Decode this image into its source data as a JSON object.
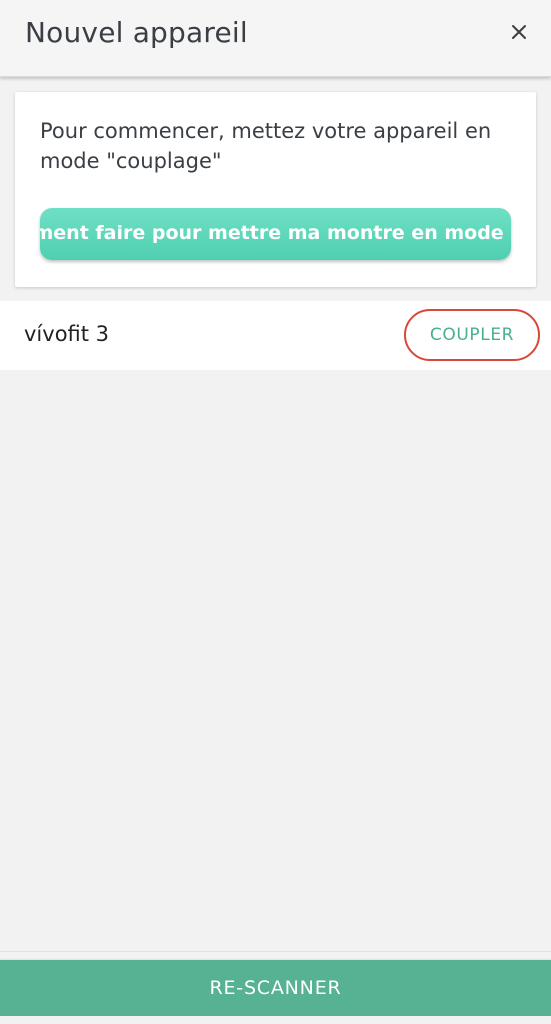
{
  "header": {
    "title": "Nouvel appareil",
    "close_icon": "close-icon"
  },
  "card": {
    "instruction": "Pour commencer, mettez votre appareil en mode \"couplage\"",
    "help_link": "Comment faire pour mettre ma montre en mode \"couplage\" ?"
  },
  "device": {
    "name": "vívofit 3",
    "pair_label": "COUPLER",
    "highlight_color": "#d9483a"
  },
  "footer": {
    "rescan_label": "RE-SCANNER"
  },
  "colors": {
    "accent": "#57b193",
    "link_gradient_start": "#6fe0c4",
    "link_gradient_end": "#4fcfb1"
  }
}
